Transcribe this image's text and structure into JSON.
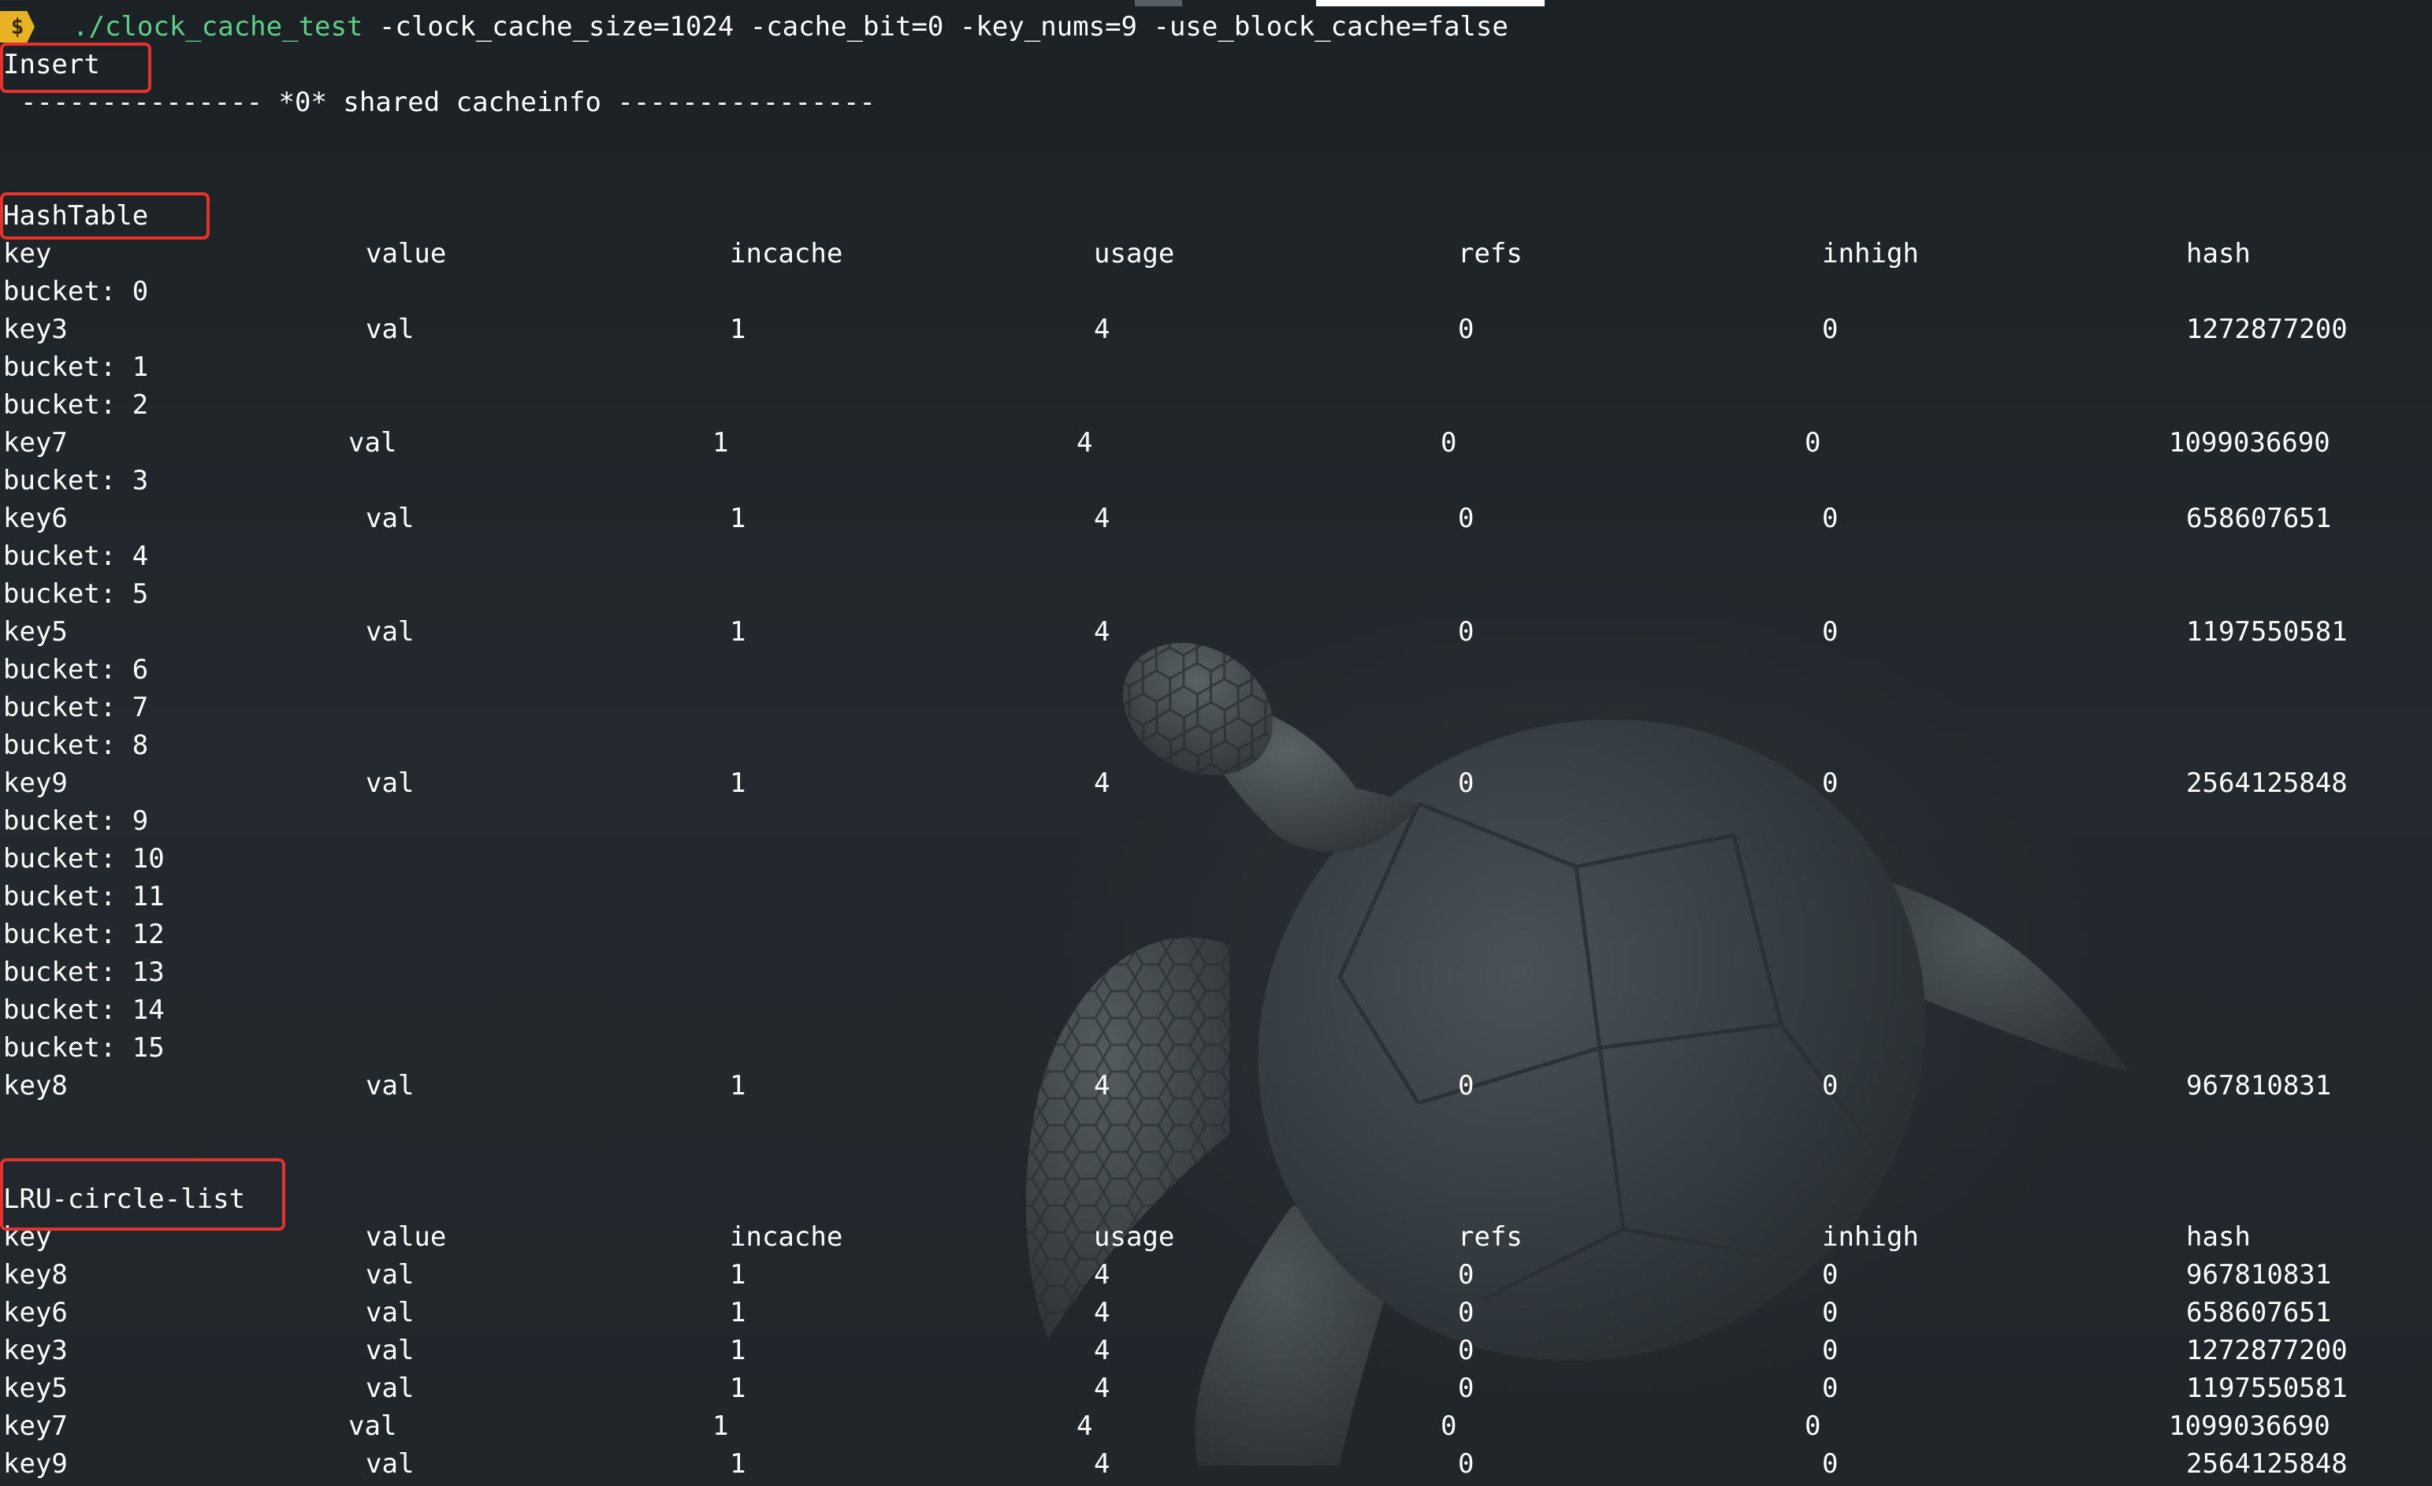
{
  "terminal": {
    "prompt_symbol": "$",
    "command_exec": "./clock_cache_test",
    "command_args": " -clock_cache_size=1024 -cache_bit=0 -key_nums=9 -use_block_cache=false"
  },
  "sections": {
    "insert_label": "Insert",
    "shard_banner": "--------------- *0* shared cacheinfo ----------------",
    "hashtable_label": "HashTable",
    "lru_label": "LRU-circle-list"
  },
  "columns": [
    "key",
    "value",
    "incache",
    "usage",
    "refs",
    "inhigh",
    "hash"
  ],
  "hashtable_lines": [
    {
      "type": "bucket",
      "text": "bucket: 0"
    },
    {
      "type": "entry",
      "cells": [
        "key3",
        "val",
        "1",
        "4",
        "0",
        "0",
        "1272877200"
      ]
    },
    {
      "type": "bucket",
      "text": "bucket: 1"
    },
    {
      "type": "bucket",
      "text": "bucket: 2"
    },
    {
      "type": "entry",
      "shifted": true,
      "cells": [
        "key7",
        "val",
        "1",
        "4",
        "0",
        "0",
        "1099036690"
      ]
    },
    {
      "type": "bucket",
      "text": "bucket: 3"
    },
    {
      "type": "entry",
      "cells": [
        "key6",
        "val",
        "1",
        "4",
        "0",
        "0",
        "658607651"
      ]
    },
    {
      "type": "bucket",
      "text": "bucket: 4"
    },
    {
      "type": "bucket",
      "text": "bucket: 5"
    },
    {
      "type": "entry",
      "cells": [
        "key5",
        "val",
        "1",
        "4",
        "0",
        "0",
        "1197550581"
      ]
    },
    {
      "type": "bucket",
      "text": "bucket: 6"
    },
    {
      "type": "bucket",
      "text": "bucket: 7"
    },
    {
      "type": "bucket",
      "text": "bucket: 8"
    },
    {
      "type": "entry",
      "cells": [
        "key9",
        "val",
        "1",
        "4",
        "0",
        "0",
        "2564125848"
      ]
    },
    {
      "type": "bucket",
      "text": "bucket: 9"
    },
    {
      "type": "bucket",
      "text": "bucket: 10"
    },
    {
      "type": "bucket",
      "text": "bucket: 11"
    },
    {
      "type": "bucket",
      "text": "bucket: 12"
    },
    {
      "type": "bucket",
      "text": "bucket: 13"
    },
    {
      "type": "bucket",
      "text": "bucket: 14"
    },
    {
      "type": "bucket",
      "text": "bucket: 15"
    },
    {
      "type": "entry",
      "cells": [
        "key8",
        "val",
        "1",
        "4",
        "0",
        "0",
        "967810831"
      ]
    }
  ],
  "lru_rows": [
    {
      "shifted": false,
      "cells": [
        "key8",
        "val",
        "1",
        "4",
        "0",
        "0",
        "967810831"
      ]
    },
    {
      "shifted": false,
      "cells": [
        "key6",
        "val",
        "1",
        "4",
        "0",
        "0",
        "658607651"
      ]
    },
    {
      "shifted": false,
      "cells": [
        "key3",
        "val",
        "1",
        "4",
        "0",
        "0",
        "1272877200"
      ]
    },
    {
      "shifted": false,
      "cells": [
        "key5",
        "val",
        "1",
        "4",
        "0",
        "0",
        "1197550581"
      ]
    },
    {
      "shifted": true,
      "cells": [
        "key7",
        "val",
        "1",
        "4",
        "0",
        "0",
        "1099036690"
      ]
    },
    {
      "shifted": false,
      "cells": [
        "key9",
        "val",
        "1",
        "4",
        "0",
        "0",
        "2564125848"
      ]
    }
  ],
  "colors": {
    "background": "#1f2428",
    "text": "#ffffff",
    "command": "#5ecf86",
    "prompt_badge": "#e7b224",
    "highlight_box": "#e5322d"
  }
}
